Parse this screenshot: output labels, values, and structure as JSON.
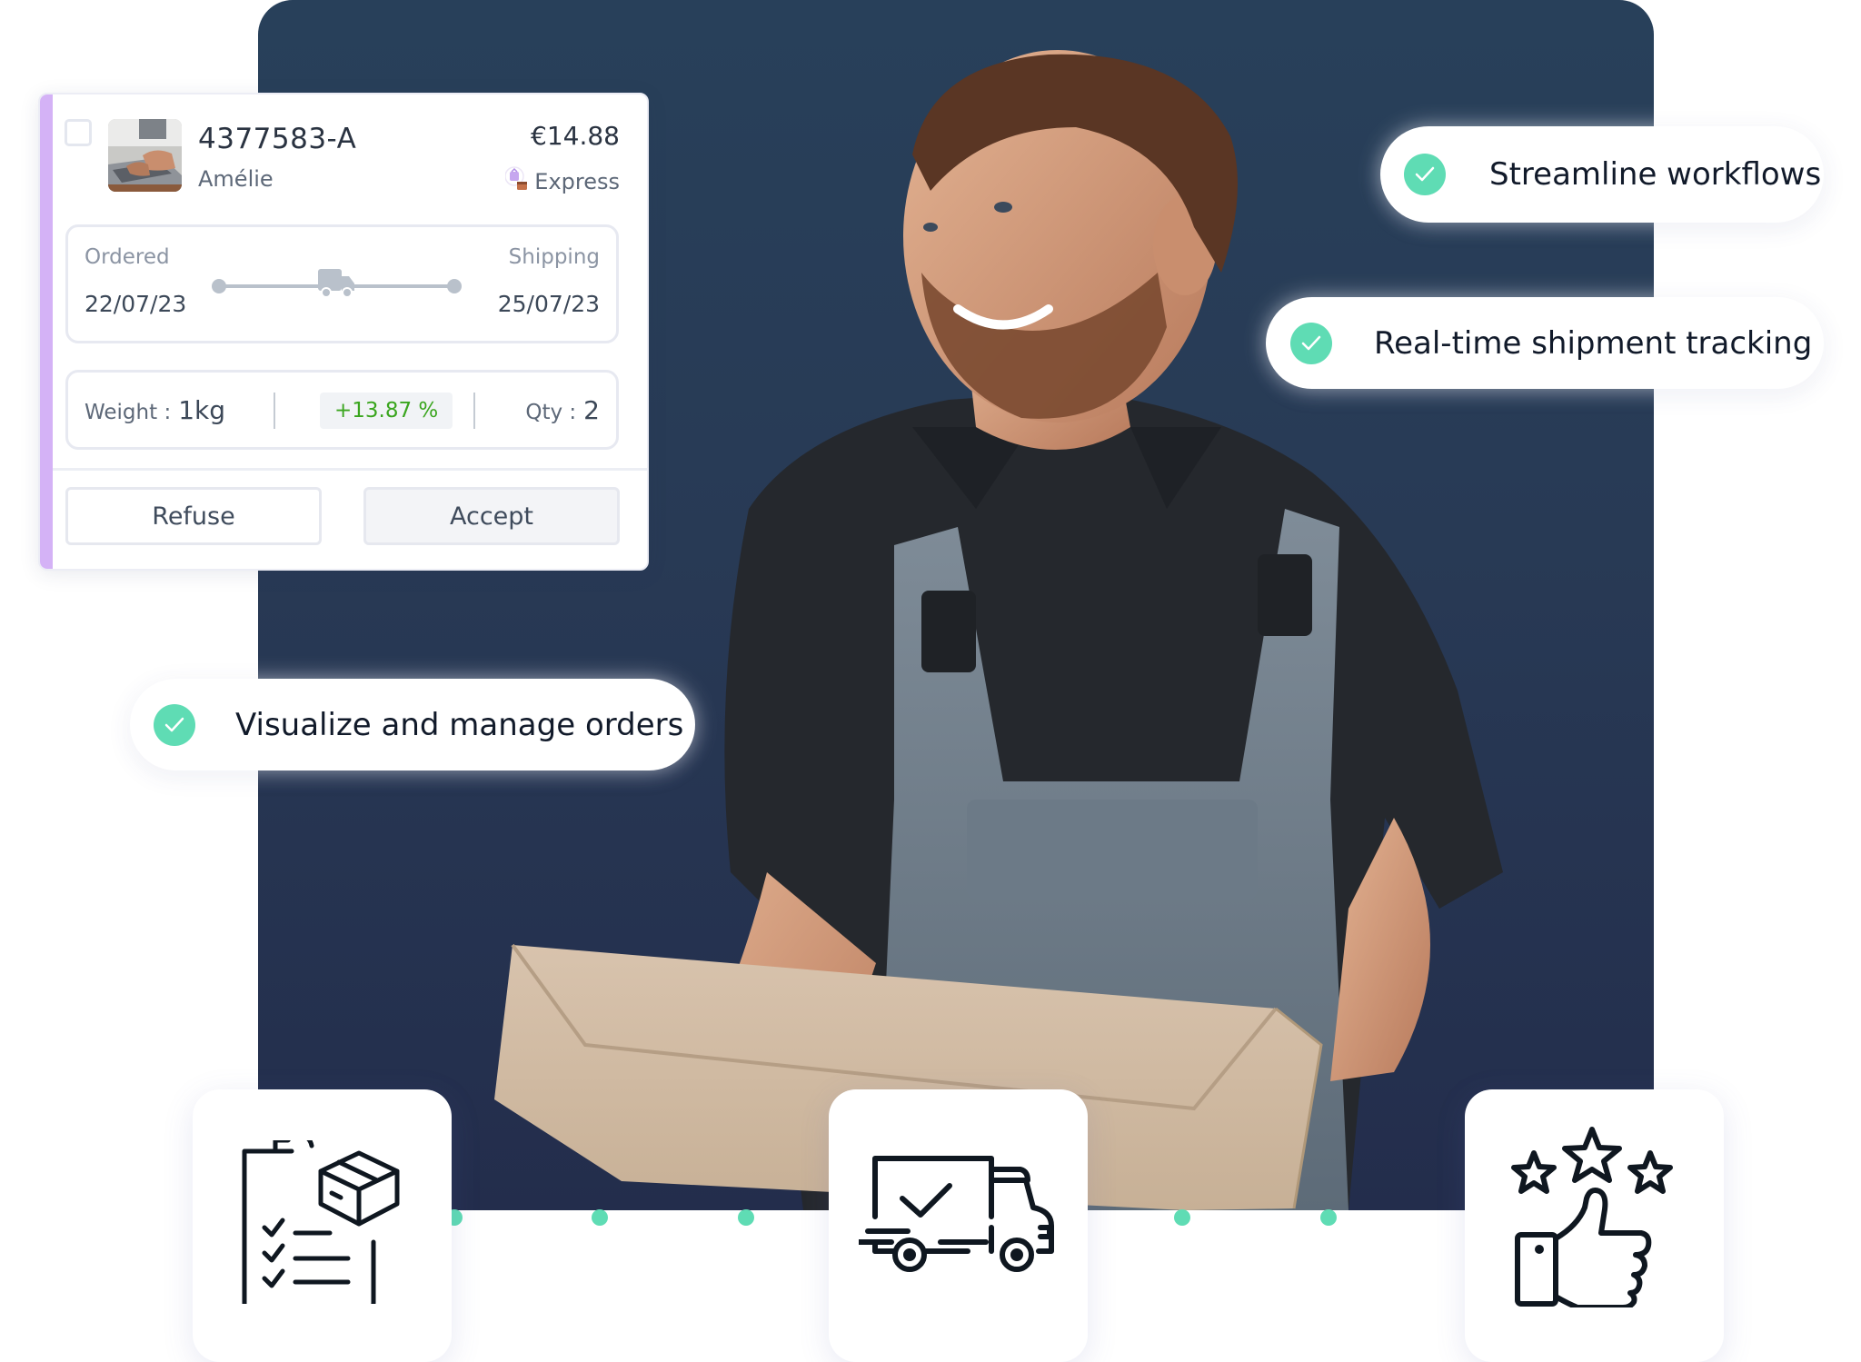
{
  "order_card": {
    "order_id": "4377583-A",
    "customer_name": "Amélie",
    "price": "€14.88",
    "shipping_method": "Express",
    "shipping_method_icon": "express-package-icon",
    "thumbnail": "laptop-typing-photo",
    "selected": false,
    "timeline": {
      "ordered_label": "Ordered",
      "ordered_date": "22/07/23",
      "shipping_label": "Shipping",
      "shipping_date": "25/07/23",
      "progress_icon": "truck-icon",
      "progress_fraction": 0.5
    },
    "stats": {
      "weight_label": "Weight :",
      "weight_value": "1kg",
      "change": "+13.87 %",
      "qty_label": "Qty :",
      "qty_value": "2"
    },
    "actions": {
      "refuse_label": "Refuse",
      "accept_label": "Accept"
    }
  },
  "features": [
    {
      "label": "Streamline workflows",
      "icon": "check-circle-icon"
    },
    {
      "label": "Real-time shipment tracking",
      "icon": "check-circle-icon"
    },
    {
      "label": "Visualize and manage orders",
      "icon": "check-circle-icon"
    }
  ],
  "tiles": [
    {
      "icon": "clipboard-checklist-package-icon"
    },
    {
      "icon": "delivery-truck-check-icon"
    },
    {
      "icon": "thumbs-up-stars-rating-icon"
    }
  ],
  "hero_image": "smiling delivery worker in overalls holding cardboard box",
  "colors": {
    "panel": "#27384f",
    "accent_teal": "#5fdcb4",
    "card_stripe": "#d4b2f6",
    "positive_green": "#3aa51e"
  }
}
